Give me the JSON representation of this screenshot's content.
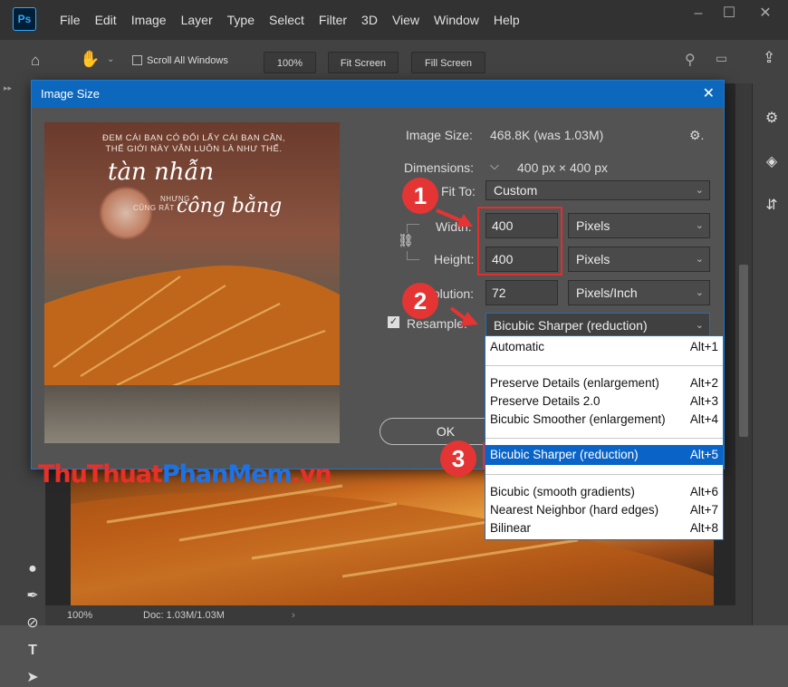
{
  "app": {
    "logo": "Ps"
  },
  "menu": [
    "File",
    "Edit",
    "Image",
    "Layer",
    "Type",
    "Select",
    "Filter",
    "3D",
    "View",
    "Window",
    "Help"
  ],
  "options": {
    "scroll_all": "Scroll All Windows",
    "zoom": "100%",
    "fit_screen": "Fit Screen",
    "fill_screen": "Fill Screen"
  },
  "status": {
    "zoom": "100%",
    "doc": "Doc: 1.03M/1.03M"
  },
  "dialog": {
    "title": "Image Size",
    "image_size_label": "Image Size:",
    "image_size_value": "468.8K (was 1.03M)",
    "dimensions_label": "Dimensions:",
    "dimensions_value": "400 px  ×  400 px",
    "fit_to_label": "Fit To:",
    "fit_to_value": "Custom",
    "width_label": "Width:",
    "width_value": "400",
    "width_unit": "Pixels",
    "height_label": "Height:",
    "height_value": "400",
    "height_unit": "Pixels",
    "resolution_label": "Resolution:",
    "resolution_value": "72",
    "resolution_unit": "Pixels/Inch",
    "resample_label": "Resample:",
    "resample_value": "Bicubic Sharper (reduction)",
    "ok_label": "OK",
    "preview": {
      "line1": "ĐEM CÁI BẠN CÓ ĐỔI LẤY CÁI BẠN CẦN,",
      "line2": "THẾ GIỚI NÀY VẪN LUÔN LÀ NHƯ THẾ.",
      "script1": "tàn nhẫn",
      "small1": "NHƯNG",
      "small2": "CŨNG RẤT",
      "script2": "công bằng"
    }
  },
  "dropdown": [
    {
      "label": "Automatic",
      "shortcut": "Alt+1"
    },
    {
      "label": "Preserve Details (enlargement)",
      "shortcut": "Alt+2"
    },
    {
      "label": "Preserve Details 2.0",
      "shortcut": "Alt+3"
    },
    {
      "label": "Bicubic Smoother (enlargement)",
      "shortcut": "Alt+4"
    },
    {
      "label": "Bicubic Sharper (reduction)",
      "shortcut": "Alt+5",
      "selected": true
    },
    {
      "label": "Bicubic (smooth gradients)",
      "shortcut": "Alt+6"
    },
    {
      "label": "Nearest Neighbor (hard edges)",
      "shortcut": "Alt+7"
    },
    {
      "label": "Bilinear",
      "shortcut": "Alt+8"
    }
  ],
  "badges": [
    "1",
    "2",
    "3"
  ],
  "watermark": {
    "part1": "ThuThuat",
    "part2": "PhanMem",
    ".vn": ".vn"
  },
  "colors": {
    "accent": "#0a64c8",
    "highlight": "#e62d2d",
    "ps_blue": "#31a8ff"
  }
}
